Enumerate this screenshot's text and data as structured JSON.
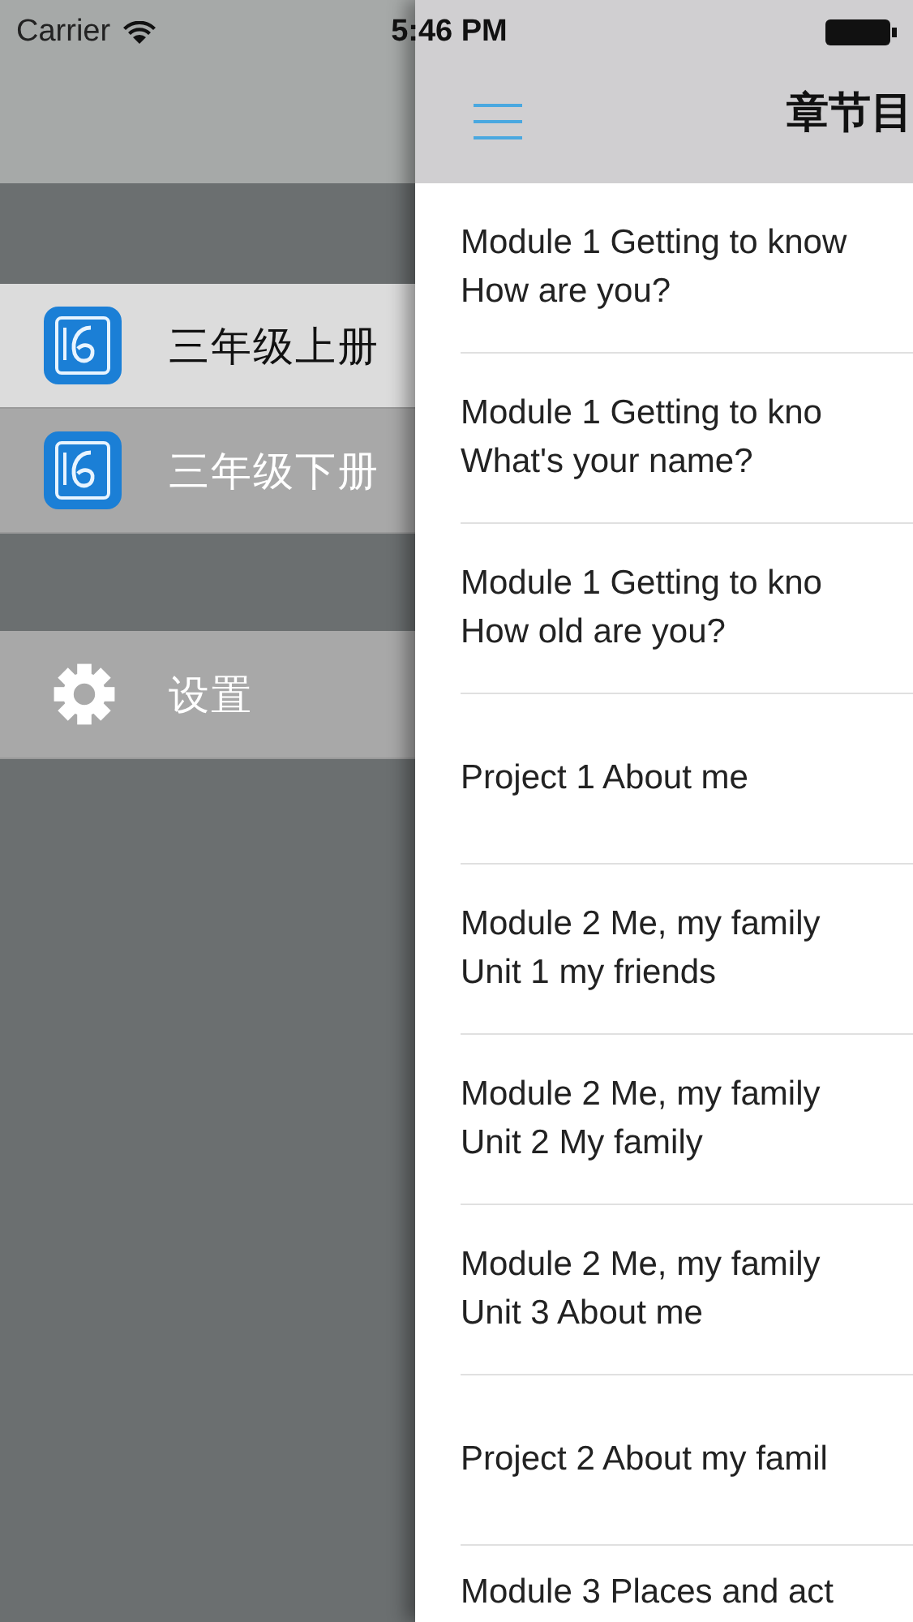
{
  "status_bar": {
    "carrier": "Carrier",
    "time": "5:46 PM"
  },
  "side_menu": {
    "books": [
      {
        "label": "三年级上册",
        "selected": true
      },
      {
        "label": "三年级下册",
        "selected": false
      }
    ],
    "settings": {
      "label": "设置"
    }
  },
  "chapter_list": {
    "title": "章节目",
    "items": [
      {
        "lines": [
          "Module 1 Getting to know",
          "How are you?"
        ]
      },
      {
        "lines": [
          "Module 1 Getting to kno",
          "What's your name?"
        ]
      },
      {
        "lines": [
          "Module 1 Getting to kno",
          "How old are you?"
        ]
      },
      {
        "lines": [
          "Project 1 About me"
        ]
      },
      {
        "lines": [
          "Module 2 Me, my family",
          "Unit 1 my friends"
        ]
      },
      {
        "lines": [
          "Module 2 Me, my family",
          "Unit 2 My family"
        ]
      },
      {
        "lines": [
          "Module 2 Me, my family",
          "Unit 3 About me"
        ]
      },
      {
        "lines": [
          "Project 2 About my famil"
        ]
      },
      {
        "lines": [
          "Module 3 Places and act"
        ]
      }
    ]
  }
}
